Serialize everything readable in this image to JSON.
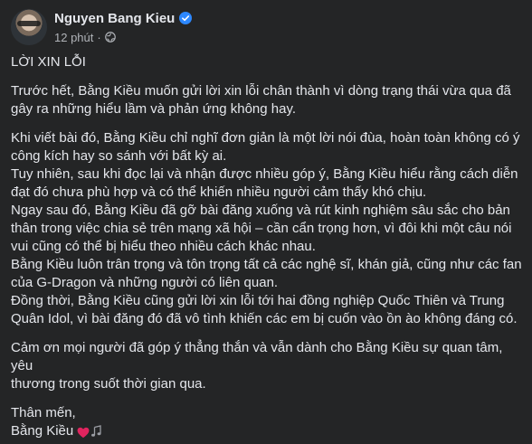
{
  "author": {
    "name": "Nguyen Bang Kieu",
    "time": "12 phút",
    "separator": "·",
    "verified_color": "#2d88ff",
    "privacy_icon": "globe-icon"
  },
  "post": {
    "title": "LỜI XIN LỖI",
    "paragraph_1": [
      "Trước hết, Bằng Kiều muốn gửi lời xin lỗi chân thành vì dòng trạng thái vừa qua đã",
      "gây ra những hiểu lầm và phản ứng không hay."
    ],
    "paragraph_2": [
      "Khi viết bài đó, Bằng Kiều chỉ nghĩ đơn giản là một lời nói đùa, hoàn toàn không có ý",
      "công kích hay so sánh với bất kỳ ai.",
      "Tuy nhiên, sau khi đọc lại và nhận được nhiều góp ý, Bằng Kiều hiểu rằng cách diễn",
      "đạt đó chưa phù hợp và có thể khiến nhiều người cảm thấy khó chịu.",
      "Ngay sau đó, Bằng Kiều đã gỡ bài đăng xuống và rút kinh nghiệm sâu sắc cho bản",
      "thân trong việc chia sẻ trên mạng xã hội – cần cẩn trọng hơn, vì đôi khi một câu nói",
      "vui cũng có thể bị hiểu theo nhiều cách khác nhau.",
      "Bằng Kiều luôn trân trọng và tôn trọng tất cả các nghệ sĩ, khán giả, cũng như các fan",
      "của G-Dragon và những người có liên quan.",
      "Đồng thời, Bằng Kiều cũng gửi lời xin lỗi tới hai đồng nghiệp Quốc Thiên và Trung",
      "Quân Idol, vì bài đăng đó đã vô tình khiến các em bị cuốn vào ồn ào không đáng có."
    ],
    "paragraph_3": [
      "Cảm ơn mọi người đã góp ý thẳng thắn và vẫn dành cho Bằng Kiều sự quan tâm, yêu",
      "thương trong suốt thời gian qua."
    ],
    "closing": "Thân mến,",
    "signature": "Bằng Kiều",
    "signature_icons": [
      "heart-icon",
      "music-note-icon"
    ],
    "heart_color": "#e0245e"
  }
}
